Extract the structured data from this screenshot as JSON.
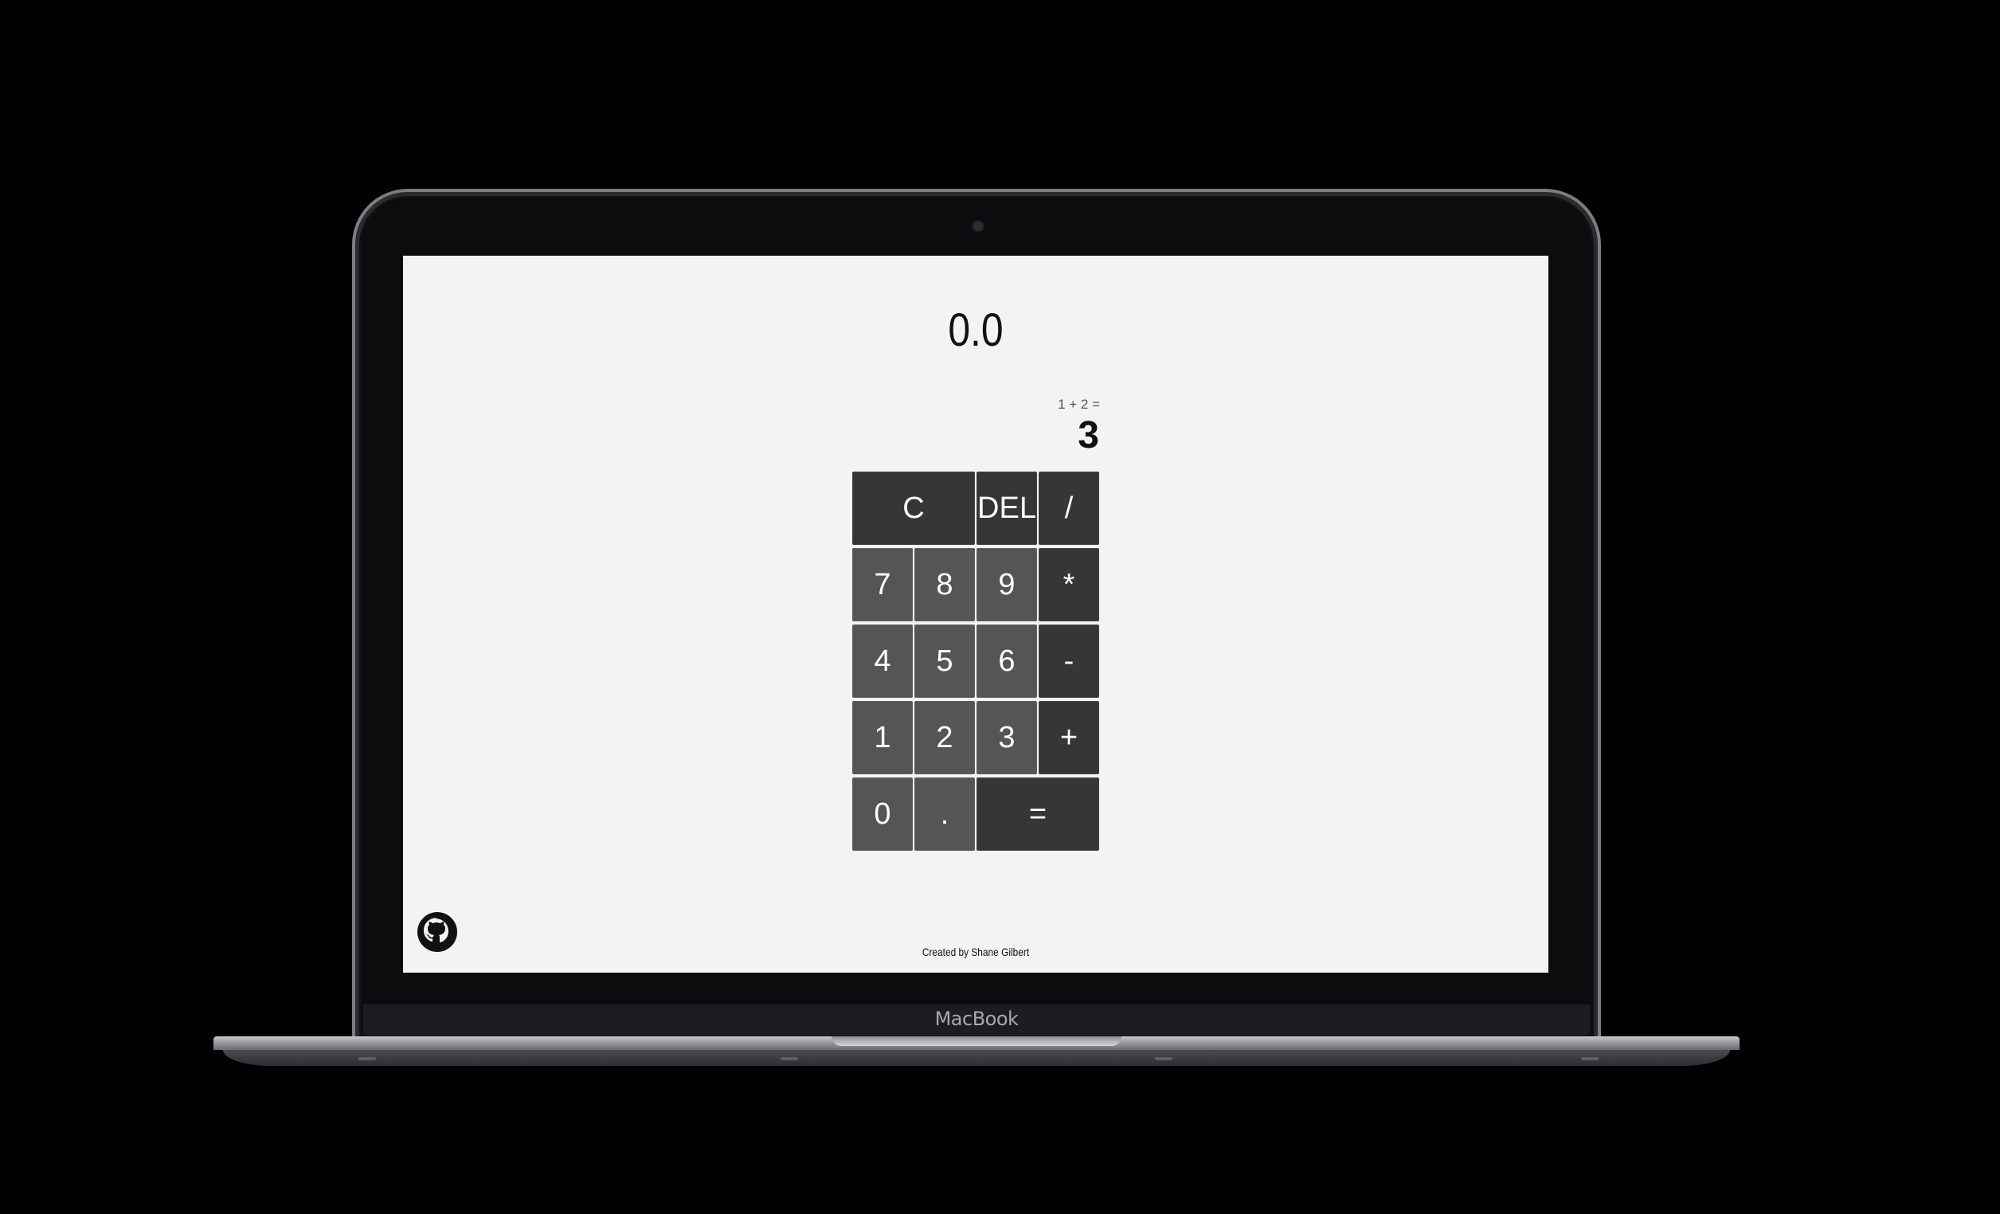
{
  "device": {
    "brand_label": "MacBook"
  },
  "app": {
    "title": "0.0",
    "history": "1 + 2 =",
    "result": "3",
    "keys": {
      "clear": "C",
      "delete": "DEL",
      "divide": "/",
      "seven": "7",
      "eight": "8",
      "nine": "9",
      "multiply": "*",
      "four": "4",
      "five": "5",
      "six": "6",
      "subtract": "-",
      "one": "1",
      "two": "2",
      "three": "3",
      "add": "+",
      "zero": "0",
      "decimal": ".",
      "equals": "="
    },
    "footer": {
      "credit": "Created by Shane Gilbert",
      "github_icon": "github-icon"
    }
  },
  "colors": {
    "screen_background": "#f3f3f3",
    "number_key": "#555555",
    "operator_key": "#363636"
  }
}
